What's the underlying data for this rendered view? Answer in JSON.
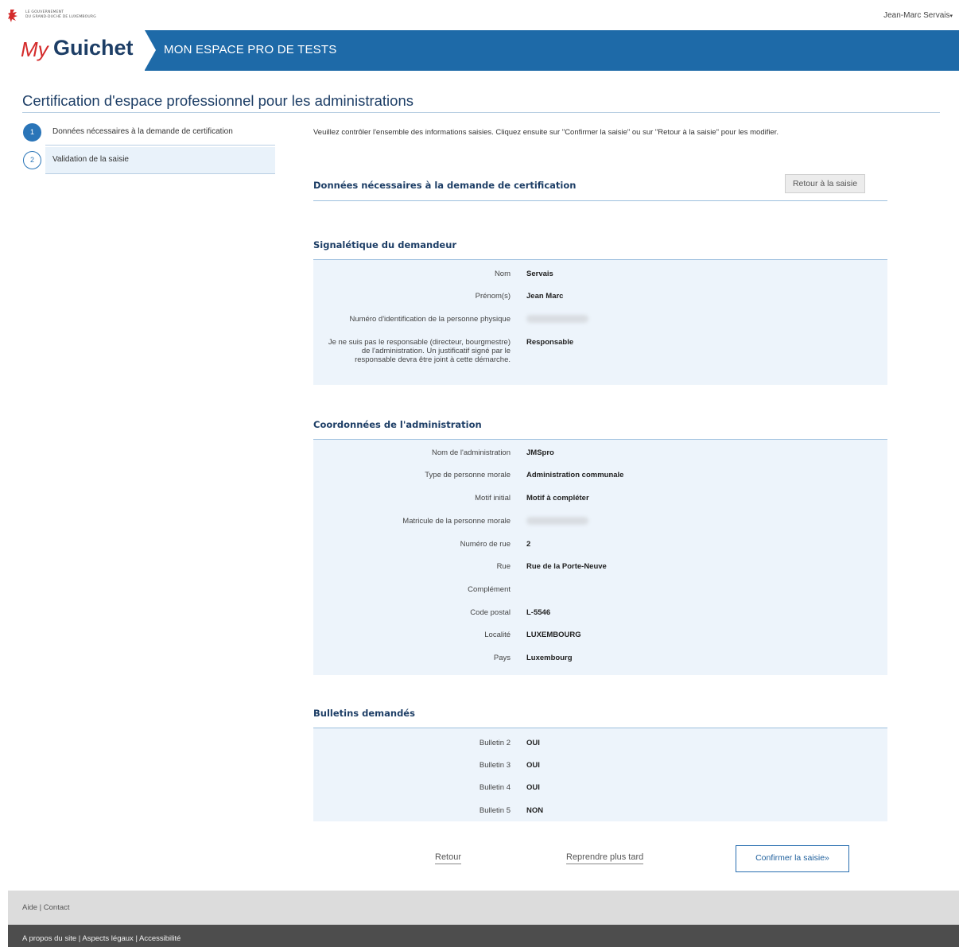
{
  "header": {
    "gov_text_line1": "LE GOUVERNEMENT",
    "gov_text_line2": "DU GRAND-DUCHÉ DE LUXEMBOURG",
    "user_name": "Jean-Marc Servais",
    "logo_my": "My",
    "logo_guichet": "Guichet",
    "space_title": "MON ESPACE PRO DE TESTS",
    "brand_color": "#1e6aa8",
    "logo_icon": "lion-icon",
    "user_menu_icon": "caret-down-icon"
  },
  "page_title": "Certification d'espace professionnel pour les administrations",
  "steps": [
    {
      "number": "1",
      "label": "Données nécessaires à la demande de certification",
      "active": true
    },
    {
      "number": "2",
      "label": "Validation de la saisie",
      "active": false
    }
  ],
  "intro": "Veuillez contrôler l'ensemble des informations saisies. Cliquez ensuite sur \"Confirmer la saisie\" ou sur \"Retour à la saisie\" pour les modifier.",
  "main_section": {
    "title": "Données nécessaires à la demande de certification",
    "back_button": "Retour à la saisie"
  },
  "applicant": {
    "title": "Signalétique du demandeur",
    "rows": [
      {
        "label": "Nom",
        "value": "Servais"
      },
      {
        "label": "Prénom(s)",
        "value": "Jean Marc"
      },
      {
        "label": "Numéro d'identification de la personne physique",
        "value": ""
      },
      {
        "label": "Je ne suis pas le responsable (directeur, bourgmestre) de l'administration. Un justificatif signé par le responsable devra être joint à cette démarche.",
        "value": "Responsable"
      }
    ]
  },
  "administration": {
    "title": "Coordonnées de l'administration",
    "rows": [
      {
        "label": "Nom de l'administration",
        "value": "JMSpro"
      },
      {
        "label": "Type de personne morale",
        "value": "Administration communale"
      },
      {
        "label": "Motif initial",
        "value": "Motif à compléter"
      },
      {
        "label": "Matricule de la personne morale",
        "value": ""
      },
      {
        "label": "Numéro de rue",
        "value": "2"
      },
      {
        "label": "Rue",
        "value": "Rue de la Porte-Neuve"
      },
      {
        "label": "Complément",
        "value": ""
      },
      {
        "label": "Code postal",
        "value": "L-5546"
      },
      {
        "label": "Localité",
        "value": "LUXEMBOURG"
      },
      {
        "label": "Pays",
        "value": "Luxembourg"
      }
    ]
  },
  "bulletins": {
    "title": "Bulletins demandés",
    "rows": [
      {
        "label": "Bulletin 2",
        "value": "OUI"
      },
      {
        "label": "Bulletin 3",
        "value": "OUI"
      },
      {
        "label": "Bulletin 4",
        "value": "OUI"
      },
      {
        "label": "Bulletin 5",
        "value": "NON"
      }
    ]
  },
  "actions": {
    "back": "Retour",
    "later": "Reprendre plus tard",
    "confirm": "Confirmer la saisie»"
  },
  "footer": {
    "help": "Aide",
    "contact": "Contact",
    "about": "A propos du site",
    "legal": "Aspects légaux",
    "accessibility": "Accessibilité",
    "separator": "|"
  }
}
